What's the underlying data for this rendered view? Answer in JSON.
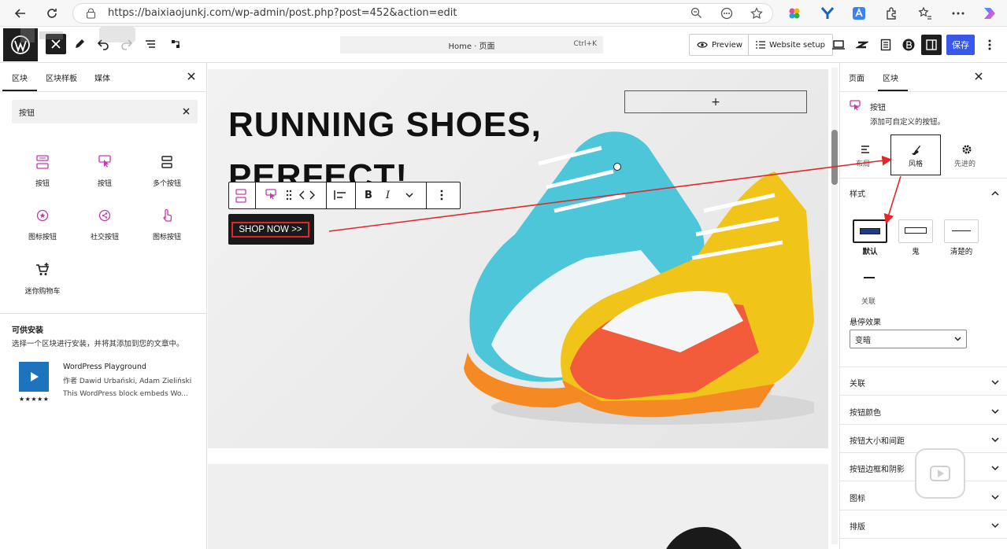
{
  "browser": {
    "url": "https://baixiaojunkj.com/wp-admin/post.php?post=452&action=edit"
  },
  "toolbar": {
    "command_title": "Home · 页面",
    "command_shortcut": "Ctrl+K",
    "preview_label": "Preview",
    "website_setup_label": "Website setup",
    "save_label": "保存"
  },
  "inserter": {
    "tabs": [
      "区块",
      "区块样板",
      "媒体"
    ],
    "search_value": "按钮",
    "blocks": [
      {
        "label": "按钮",
        "icon": "buttons-icon"
      },
      {
        "label": "按钮",
        "icon": "pointer-button-icon"
      },
      {
        "label": "多个按钮",
        "icon": "multi-buttons-icon"
      },
      {
        "label": "图标按钮",
        "icon": "star-circle-icon"
      },
      {
        "label": "社交按钮",
        "icon": "share-icon"
      },
      {
        "label": "图标按钮",
        "icon": "hand-pointer-icon"
      },
      {
        "label": "迷你购物车",
        "icon": "cart-icon"
      }
    ],
    "installable_title": "可供安装",
    "installable_desc": "选择一个区块进行安装，并将其添加到您的文章中。",
    "plugin": {
      "name": "WordPress Playground",
      "author": "作者 Dawid Urbański, Adam Zieliński",
      "desc": "This WordPress block embeds Wo...",
      "rating": "★★★★★"
    }
  },
  "canvas": {
    "heading_line1": "RUNNING SHOES,",
    "heading_line2": "PERFECT!",
    "button_text": "SHOP NOW >>",
    "add_block": "+"
  },
  "sidebar": {
    "tabs": [
      "页面",
      "区块"
    ],
    "block_name": "按钮",
    "block_desc": "添加可自定义的按钮。",
    "subtabs": [
      "布局",
      "风格",
      "先进的"
    ],
    "styles_title": "样式",
    "style_options": [
      "默认",
      "鬼",
      "清楚的"
    ],
    "extra_option": "关联",
    "hover_label": "悬停效果",
    "hover_value": "变暗",
    "sections": [
      "关联",
      "按钮颜色",
      "按钮大小和间距",
      "按钮边框和阴影",
      "图标",
      "排版"
    ]
  },
  "colors": {
    "accent": "#3858e9",
    "annotation": "#e3262c"
  }
}
